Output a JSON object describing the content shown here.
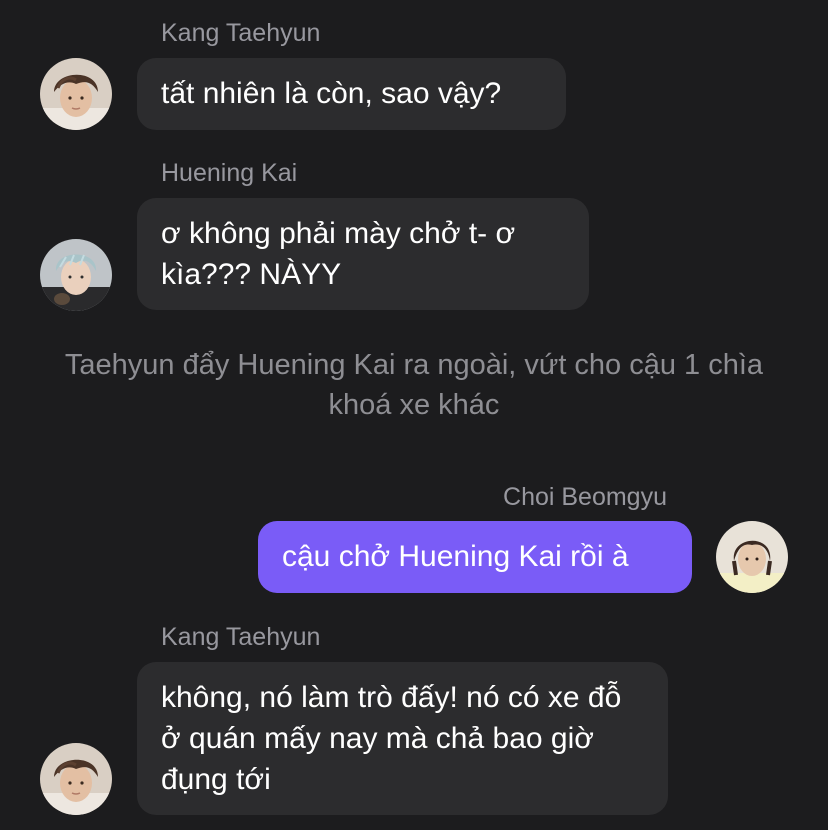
{
  "messages": [
    {
      "sender": "Kang Taehyun",
      "avatar_icon": "avatar-kang-taehyun",
      "text": "tất nhiên là còn, sao vậy?",
      "direction": "incoming"
    },
    {
      "sender": "Huening Kai",
      "avatar_icon": "avatar-huening-kai",
      "text": "ơ không phải mày chở t- ơ kìa??? NÀYY",
      "direction": "incoming"
    },
    {
      "sender": "Choi Beomgyu",
      "avatar_icon": "avatar-choi-beomgyu",
      "text": "cậu chở Huening Kai rồi à",
      "direction": "outgoing"
    },
    {
      "sender": "Kang Taehyun",
      "avatar_icon": "avatar-kang-taehyun",
      "text": "không, nó làm trò đấy! nó có xe đỗ ở quán mấy nay mà chả bao giờ đụng tới",
      "direction": "incoming"
    }
  ],
  "narration": {
    "text": "Taehyun đẩy Huening Kai ra ngoài, vứt cho cậu 1 chìa khoá xe khác"
  },
  "colors": {
    "background": "#1c1c1e",
    "incoming_bubble": "#2c2c2e",
    "outgoing_bubble": "#7a5cf7",
    "sender_name": "#98989f",
    "narration_text": "#8e8e93"
  }
}
